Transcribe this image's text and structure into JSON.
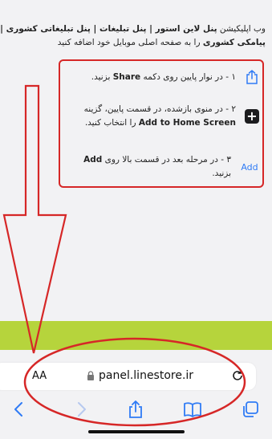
{
  "intro": {
    "line1_a": "وب اپلیکیشن ",
    "line1_b": "پنل لاین استور | پنل تبلیغات | پنل تبلیغاتی کشوری | پنل تبلیغات",
    "line2_b": "پیامکی کشوری",
    "line2_a": " را به صفحه اصلی موبایل خود اضافه کنید"
  },
  "steps": [
    {
      "pre": "۱ - در نوار پایین روی دکمه ",
      "bold": "Share",
      "post": " بزنید."
    },
    {
      "pre": "۲ - در منوی بازشده، در قسمت پایین، گزینه",
      "bold": "Add to Home Screen",
      "post": " را انتخاب کنید."
    },
    {
      "pre": "۳ - در مرحله بعد در قسمت بالا روی ",
      "bold": "Add",
      "post": " بزنید."
    }
  ],
  "step3_icon_text": "Add",
  "browser": {
    "aa_label": "AA",
    "domain": "panel.linestore.ir"
  },
  "icons": {
    "share": "share-icon",
    "add_square": "plus-square-icon",
    "lock": "lock-icon",
    "reload": "reload-icon",
    "back": "chevron-left-icon",
    "forward": "chevron-right-icon",
    "bookmarks": "book-icon",
    "tabs": "tabs-icon"
  },
  "colors": {
    "annotation_red": "#d62727",
    "ios_blue": "#2f7bf5",
    "green_bar": "#b6d43c"
  }
}
